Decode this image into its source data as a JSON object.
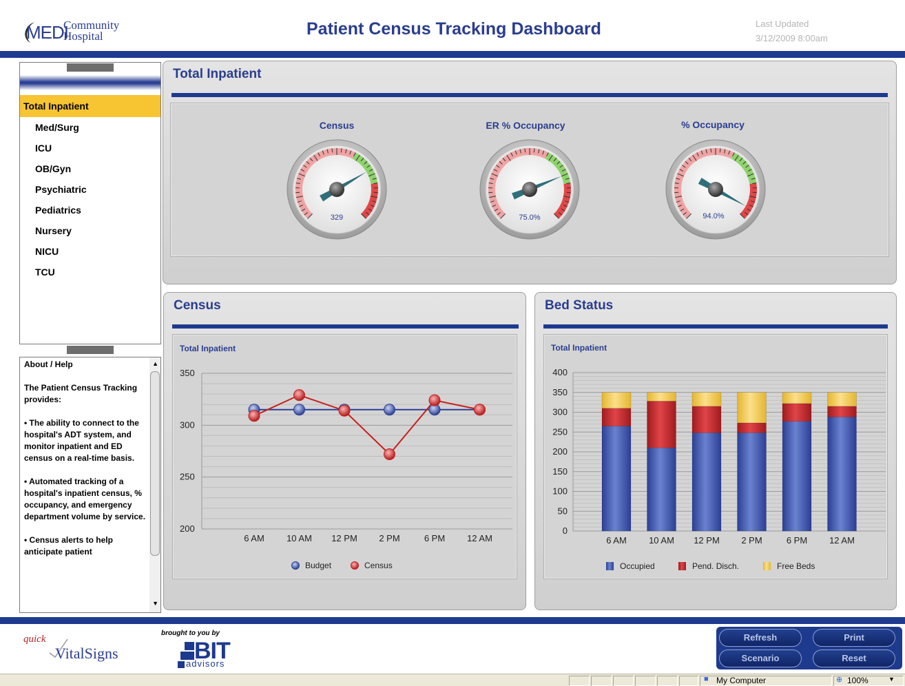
{
  "header": {
    "logo_medi": "MEDI",
    "logo_community": "Community",
    "logo_hospital": "Hospital",
    "title": "Patient Census Tracking Dashboard",
    "last_updated_label": "Last Updated",
    "last_updated_value": "3/12/2009 8:00am"
  },
  "sidebar": {
    "items": [
      {
        "label": "Total Inpatient",
        "active": true
      },
      {
        "label": "Med/Surg"
      },
      {
        "label": "ICU"
      },
      {
        "label": "OB/Gyn"
      },
      {
        "label": "Psychiatric"
      },
      {
        "label": "Pediatrics"
      },
      {
        "label": "Nursery"
      },
      {
        "label": "NICU"
      },
      {
        "label": "TCU"
      }
    ]
  },
  "help": {
    "title": "About / Help",
    "intro": "The Patient Census Tracking provides:",
    "bullets": [
      "• The ability to connect to the hospital's ADT system, and monitor inpatient and ED census on a real-time basis.",
      "• Automated tracking of a hospital's inpatient census, % occupancy, and emergency department volume by service.",
      "• Census alerts to help anticipate patient"
    ]
  },
  "total_panel": {
    "title": "Total Inpatient",
    "gauges": [
      {
        "label": "Census",
        "value_text": "329",
        "needle_fraction": 0.72
      },
      {
        "label": "ER % Occupancy",
        "value_text": "75.0%",
        "needle_fraction": 0.75
      },
      {
        "label": "% Occupancy",
        "value_text": "94.0%",
        "needle_fraction": 0.94
      }
    ]
  },
  "census_panel": {
    "title": "Census",
    "subtitle": "Total Inpatient",
    "legend": [
      "Budget",
      "Census"
    ]
  },
  "bed_panel": {
    "title": "Bed Status",
    "subtitle": "Total Inpatient",
    "legend": [
      "Occupied",
      "Pend. Disch.",
      "Free Beds"
    ]
  },
  "footer": {
    "quick": "quick",
    "vitalsigns": "VitalSigns",
    "brought_by": "brought to you by",
    "bit": "BIT",
    "advisors": "advisors",
    "buttons": {
      "refresh": "Refresh",
      "print": "Print",
      "scenario": "Scenario",
      "reset": "Reset"
    }
  },
  "statusbar": {
    "zone": "My Computer",
    "zoom": "100%"
  },
  "colors": {
    "brand_blue": "#1e3a8f",
    "title_blue": "#2a3d8f",
    "active_item": "#f7c432",
    "budget": "#2b3f94",
    "census": "#c81e1e",
    "occupied": "#3d55a8",
    "pend_disch": "#c0262a",
    "free_beds": "#f2c84b"
  },
  "chart_data": [
    {
      "type": "line",
      "title": "Total Inpatient",
      "categories": [
        "6 AM",
        "10 AM",
        "12 PM",
        "2 PM",
        "6 PM",
        "12 AM"
      ],
      "series": [
        {
          "name": "Budget",
          "values": [
            315,
            315,
            315,
            315,
            315,
            315
          ]
        },
        {
          "name": "Census",
          "values": [
            309,
            329,
            314,
            272,
            324,
            315
          ]
        }
      ],
      "ylim": [
        200,
        350
      ],
      "yticks": [
        200,
        250,
        300,
        350
      ],
      "grid": true,
      "legend": "bottom"
    },
    {
      "type": "bar",
      "stacked": true,
      "title": "Total Inpatient",
      "categories": [
        "6 AM",
        "10 AM",
        "12 PM",
        "2 PM",
        "6 PM",
        "12 AM"
      ],
      "series": [
        {
          "name": "Occupied",
          "values": [
            265,
            210,
            248,
            248,
            277,
            288
          ]
        },
        {
          "name": "Pend. Disch.",
          "values": [
            45,
            118,
            67,
            25,
            45,
            27
          ]
        },
        {
          "name": "Free Beds",
          "values": [
            40,
            22,
            35,
            77,
            28,
            35
          ]
        }
      ],
      "ylim": [
        0,
        400
      ],
      "yticks": [
        0,
        50,
        100,
        150,
        200,
        250,
        300,
        350,
        400
      ],
      "grid": true,
      "legend": "bottom"
    }
  ]
}
